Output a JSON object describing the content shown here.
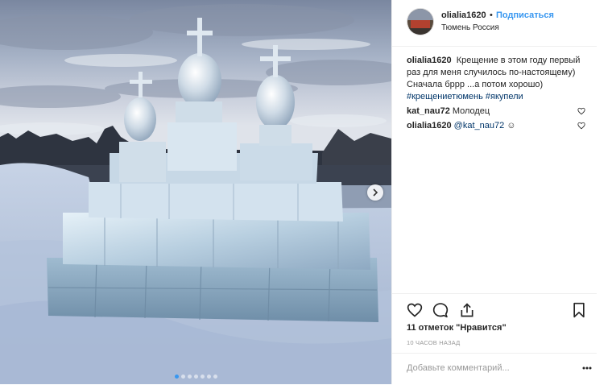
{
  "post": {
    "username": "olialia1620",
    "separator": "•",
    "follow_label": "Подписаться",
    "location": "Тюмень Россия"
  },
  "caption": {
    "username": "olialia1620",
    "text": "Крещение в этом году первый раз для меня случилось по-настоящему) Сначала бррр ...а потом хорошо)",
    "hashtags": [
      "#крещениетюмень",
      "#якупели"
    ]
  },
  "comments": [
    {
      "username": "kat_nau72",
      "text": "Молодец",
      "mention": ""
    },
    {
      "username": "olialia1620",
      "text": " ☺",
      "mention": "@kat_nau72"
    }
  ],
  "likes_label": "11 отметок \"Нравится\"",
  "time_ago": "10 часов назад",
  "comment_placeholder": "Добавьте комментарий...",
  "carousel": {
    "slides": 7,
    "active_index": 0
  },
  "icons": {
    "like": "heart-icon",
    "comment": "comment-icon",
    "share": "share-icon",
    "save": "bookmark-icon",
    "more": "more-icon",
    "next": "chevron-right-icon",
    "comment_like": "heart-icon"
  },
  "colors": {
    "link_blue": "#3897f0",
    "hashtag_blue": "#003569",
    "text": "#262626",
    "muted": "#999999",
    "divider": "#efefef"
  }
}
